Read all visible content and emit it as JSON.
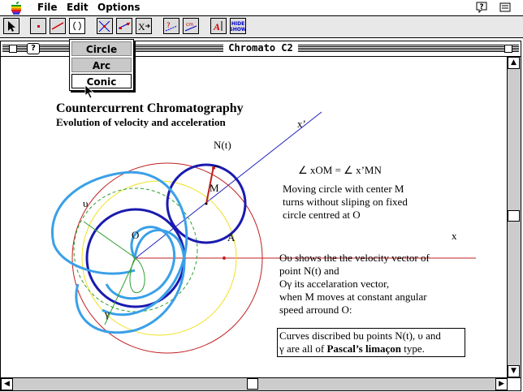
{
  "menubar": {
    "file": "File",
    "edit": "Edit",
    "options": "Options"
  },
  "toolbar": {
    "label_tool": "A",
    "hide_show": "HIDE SHOW",
    "transform": "X"
  },
  "dropdown": {
    "items": [
      "Circle",
      "Arc",
      "Conic"
    ]
  },
  "window": {
    "title": "Chromato C2"
  },
  "content": {
    "title": "Countercurrent Chromatography",
    "subtitle": "Evolution of velocity and acceleration",
    "angle_eq": "∠ xOM  = ∠ x’MN",
    "desc": [
      "Moving circle with center M",
      "turns without sliping on fixed",
      "circle centred at O"
    ],
    "velocity": [
      "Oυ shows the the velocity vector of",
      "point N(t) and",
      "Oγ  its accelaration vector,",
      "when M moves at constant angular",
      "speed arround O:"
    ],
    "box_line1": "Curves discribed bu points N(t), υ and",
    "box_line2_a": "γ are all of ",
    "box_line2_b": "Pascal’s limaçon",
    "box_line2_c": " type.",
    "labels": {
      "N": "N(t)",
      "M": "M",
      "O": "O",
      "A": "A",
      "x": "x",
      "xp": "x’",
      "upsilon": "υ",
      "gamma": "γ"
    }
  },
  "colors": {
    "dark_blue": "#1a1ab0",
    "light_blue": "#3aa0e8",
    "red": "#c02020",
    "yellow": "#f0e020",
    "green": "#30a030",
    "line_blue": "#2020c0"
  }
}
